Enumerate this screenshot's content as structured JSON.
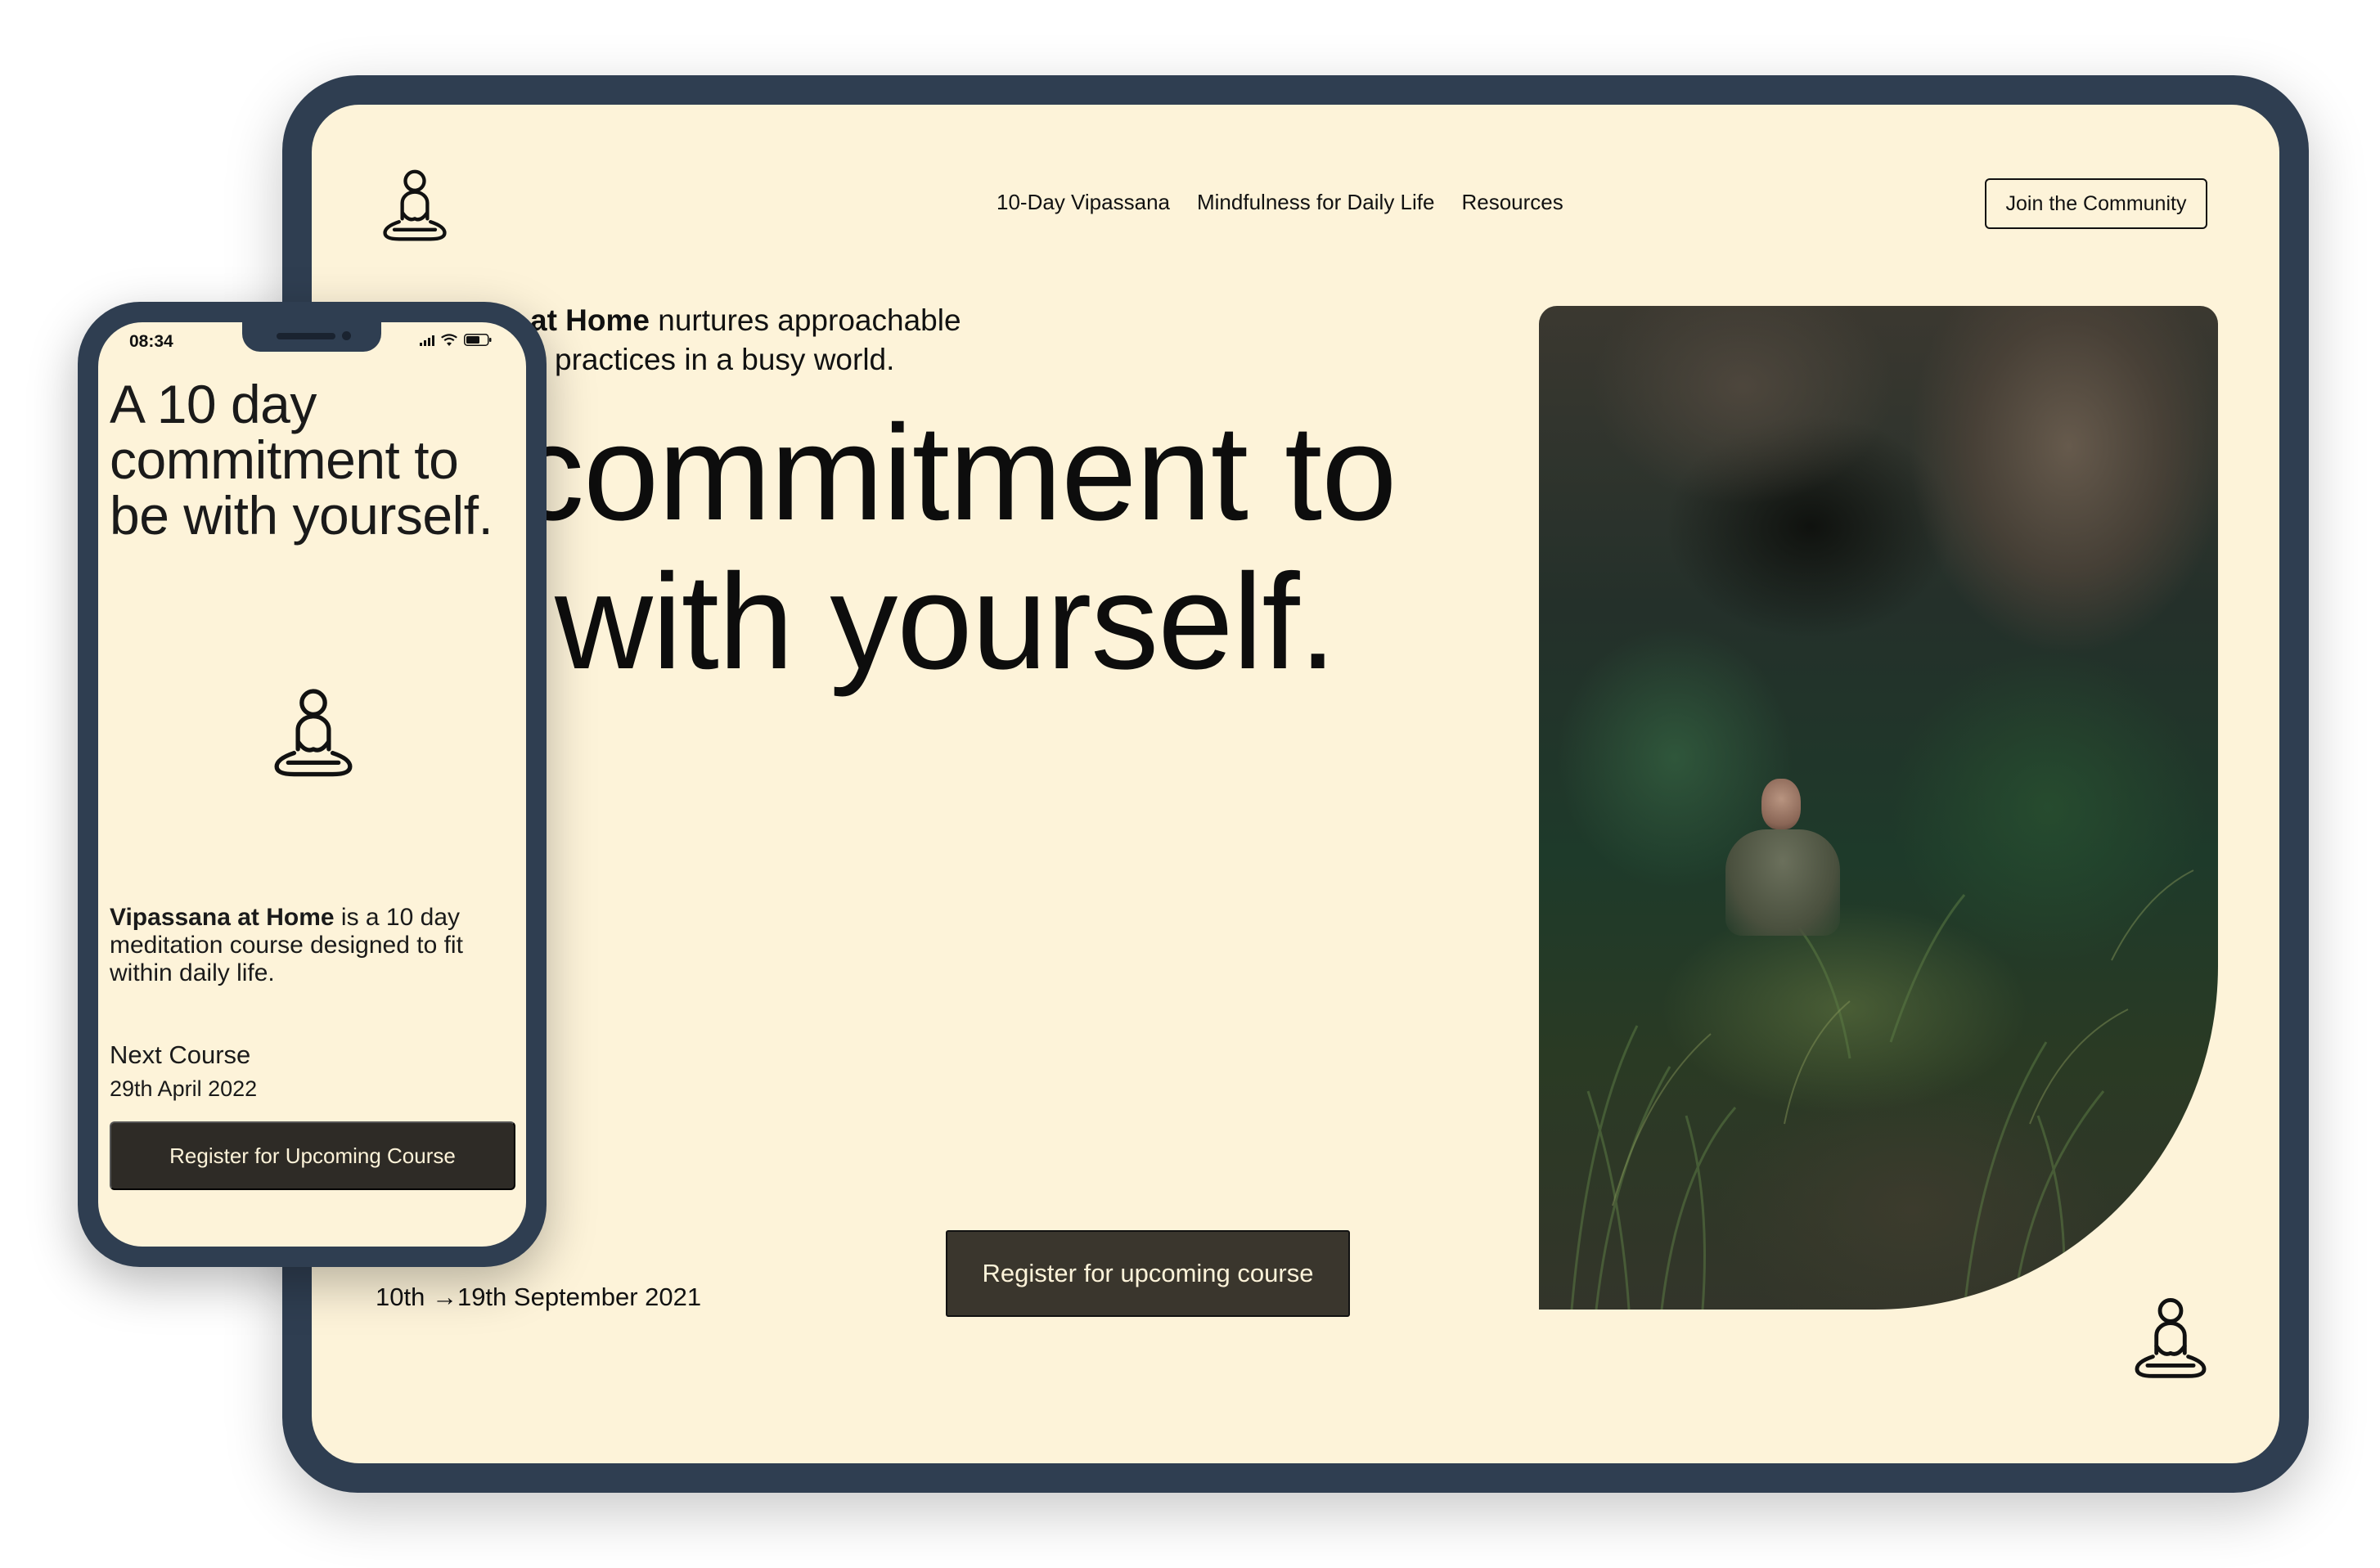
{
  "desktop": {
    "logo_icon": "meditating-person-icon",
    "nav": [
      {
        "label": "10-Day Vipassana"
      },
      {
        "label": "Mindfulness for Daily Life"
      },
      {
        "label": "Resources"
      }
    ],
    "join_button": "Join the Community",
    "intro": {
      "bold": "at Home",
      "rest_line1": " nurtures approachable",
      "line2": "practices in a busy world."
    },
    "headline_line1": "commitment to",
    "headline_line2": "with yourself.",
    "date_range": "10th →19th September 2021",
    "register_button": "Register for upcoming course",
    "corner_icon": "meditating-person-icon"
  },
  "mobile": {
    "status_time": "08:34",
    "headline": "A 10 day commitment to be with yourself.",
    "hero_icon": "meditating-person-icon",
    "desc_bold": "Vipassana at Home",
    "desc_rest": " is a 10 day meditation course designed to fit within daily life.",
    "next_course_label": "Next Course",
    "next_course_date": "29th April 2022",
    "register_button": "Register for Upcoming Course"
  },
  "colors": {
    "device_frame": "#2f3e51",
    "screen_background": "#fdf3d9",
    "button_dark": "#3a362d",
    "text": "#111111"
  }
}
